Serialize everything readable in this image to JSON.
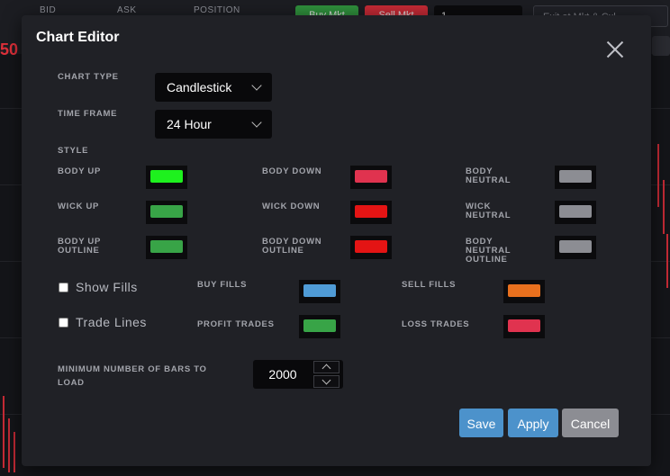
{
  "background": {
    "columns": [
      "BID",
      "ASK",
      "POSITION"
    ],
    "buy_mkt_label": "Buy Mkt",
    "sell_mkt_label": "Sell Mkt",
    "quantity_value": "1",
    "exit_dropdown_value": "Exit at Mkt & Cxl",
    "price_fragment": "50"
  },
  "modal": {
    "title": "Chart Editor",
    "chart_type": {
      "label": "CHART TYPE",
      "value": "Candlestick"
    },
    "time_frame": {
      "label": "TIME FRAME",
      "value": "24 Hour"
    },
    "style_label": "STYLE",
    "style_items": [
      {
        "key": "body_up",
        "label": "BODY UP",
        "color": "#1ef11e"
      },
      {
        "key": "body_down",
        "label": "BODY DOWN",
        "color": "#e0334f"
      },
      {
        "key": "body_neutral",
        "label": "BODY NEUTRAL",
        "color": "#8c8d93"
      },
      {
        "key": "wick_up",
        "label": "WICK UP",
        "color": "#38a447"
      },
      {
        "key": "wick_down",
        "label": "WICK DOWN",
        "color": "#e41414"
      },
      {
        "key": "wick_neutral",
        "label": "WICK NEUTRAL",
        "color": "#8c8d93"
      },
      {
        "key": "body_up_outline",
        "label": "BODY UP OUTLINE",
        "color": "#38a447"
      },
      {
        "key": "body_down_outline",
        "label": "BODY DOWN OUTLINE",
        "color": "#e41414"
      },
      {
        "key": "body_neutral_outline",
        "label": "BODY NEUTRAL OUTLINE",
        "color": "#8c8d93"
      }
    ],
    "show_fills": {
      "label": "Show Fills",
      "checked": false
    },
    "trade_lines": {
      "label": "Trade Lines",
      "checked": false
    },
    "fills": {
      "buy_fills": {
        "label": "BUY FILLS",
        "color": "#4f9bd6"
      },
      "sell_fills": {
        "label": "SELL FILLS",
        "color": "#e8701e"
      },
      "profit_trades": {
        "label": "PROFIT TRADES",
        "color": "#38a447"
      },
      "loss_trades": {
        "label": "LOSS TRADES",
        "color": "#e0334f"
      }
    },
    "min_bars": {
      "label": "MINIMUM NUMBER OF BARS TO LOAD",
      "value": "2000"
    },
    "buttons": {
      "save": {
        "label": "Save",
        "color": "#4c92cb"
      },
      "apply": {
        "label": "Apply",
        "color": "#4c92cb"
      },
      "cancel": {
        "label": "Cancel",
        "color": "#8c8d93"
      }
    }
  }
}
